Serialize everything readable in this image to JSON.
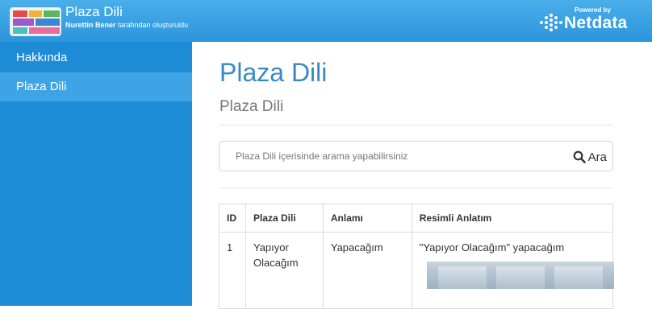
{
  "header": {
    "title": "Plaza Dili",
    "subtitle_bold": "Nurettin Bener",
    "subtitle_rest": " tarafından oluşturuldu",
    "powered_by_small": "Powered by",
    "powered_by_name": "Netdata"
  },
  "sidebar": {
    "items": [
      {
        "label": "Hakkında"
      },
      {
        "label": "Plaza Dili",
        "active": true
      }
    ]
  },
  "main": {
    "title": "Plaza Dili",
    "subtitle": "Plaza Dili",
    "search": {
      "placeholder": "Plaza Dili içerisinde arama yapabilirsiniz",
      "button_label": "Ara",
      "icon": "search-icon"
    },
    "table": {
      "headers": [
        "ID",
        "Plaza Dili",
        "Anlamı",
        "Resimli Anlatım"
      ],
      "rows": [
        {
          "id": "1",
          "plaza_dili": "Yapıyor Olacağım",
          "anlami": "Yapacağım",
          "resimli": "\"Yapıyor Olacağım\" yapacağım"
        }
      ]
    }
  },
  "colors": {
    "header": "#2b95dc",
    "sidebar": "#1d8bd6",
    "sidebar_active": "#3ea4e6",
    "title": "#3a88c4"
  }
}
